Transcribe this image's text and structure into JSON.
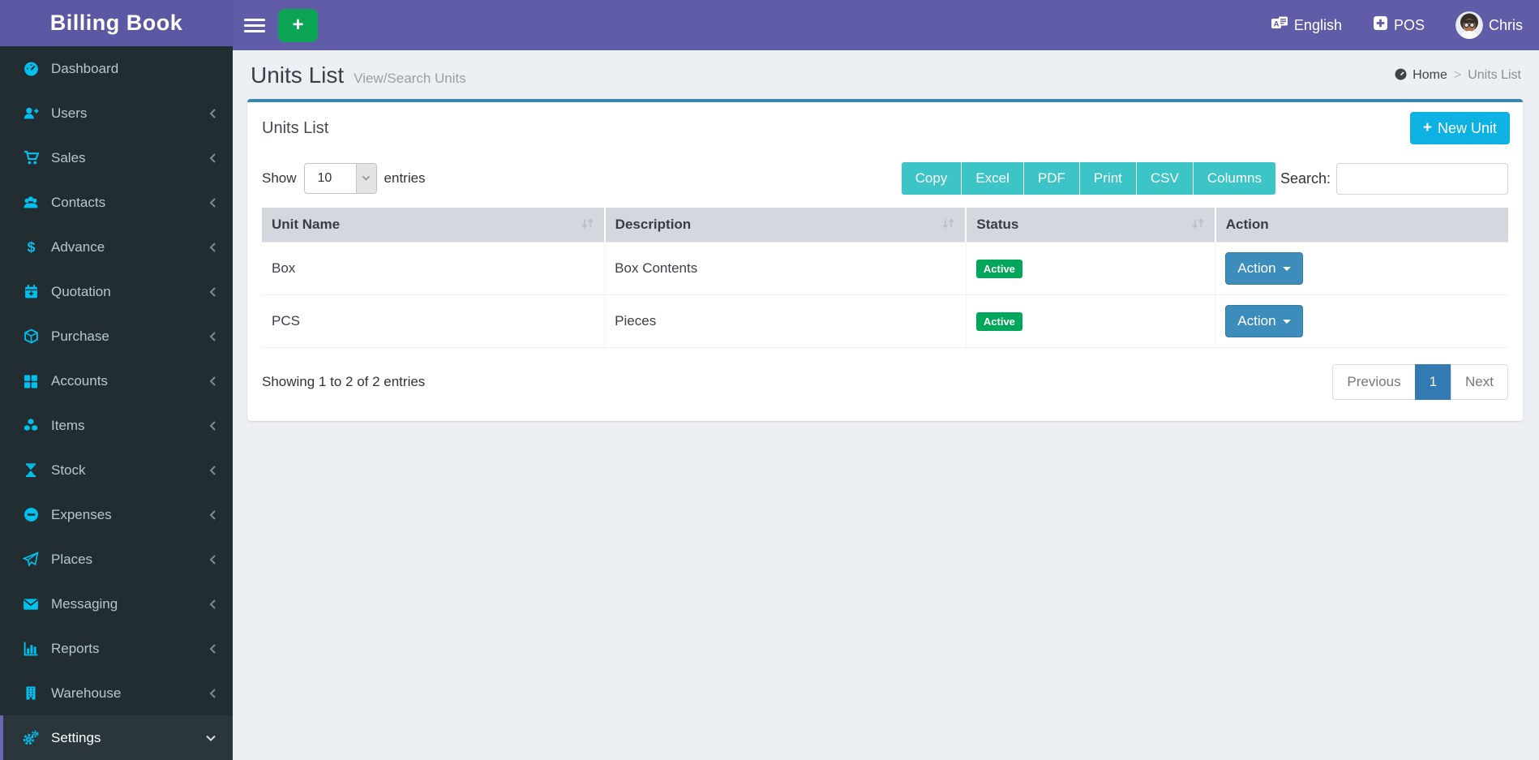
{
  "app": {
    "title": "Billing Book"
  },
  "navbar": {
    "language_label": "English",
    "pos_label": "POS",
    "user_name": "Chris",
    "icons": {
      "menu": "hamburger-icon",
      "quick_add": "plus-icon",
      "language": "language-icon",
      "pos": "plus-square-icon",
      "user": "avatar"
    }
  },
  "sidebar": {
    "items": [
      {
        "label": "Dashboard",
        "icon": "dashboard-icon",
        "expandable": false,
        "active": false
      },
      {
        "label": "Users",
        "icon": "user-plus-icon",
        "expandable": true,
        "active": false
      },
      {
        "label": "Sales",
        "icon": "cart-icon",
        "expandable": true,
        "active": false
      },
      {
        "label": "Contacts",
        "icon": "users-icon",
        "expandable": true,
        "active": false
      },
      {
        "label": "Advance",
        "icon": "dollar-icon",
        "expandable": true,
        "active": false
      },
      {
        "label": "Quotation",
        "icon": "calendar-plus-icon",
        "expandable": true,
        "active": false
      },
      {
        "label": "Purchase",
        "icon": "cube-icon",
        "expandable": true,
        "active": false
      },
      {
        "label": "Accounts",
        "icon": "grid-icon",
        "expandable": true,
        "active": false
      },
      {
        "label": "Items",
        "icon": "cubes-icon",
        "expandable": true,
        "active": false
      },
      {
        "label": "Stock",
        "icon": "hourglass-icon",
        "expandable": true,
        "active": false
      },
      {
        "label": "Expenses",
        "icon": "minus-circle-icon",
        "expandable": true,
        "active": false
      },
      {
        "label": "Places",
        "icon": "paper-plane-icon",
        "expandable": true,
        "active": false
      },
      {
        "label": "Messaging",
        "icon": "envelope-icon",
        "expandable": true,
        "active": false
      },
      {
        "label": "Reports",
        "icon": "bar-chart-icon",
        "expandable": true,
        "active": false
      },
      {
        "label": "Warehouse",
        "icon": "building-icon",
        "expandable": true,
        "active": false
      },
      {
        "label": "Settings",
        "icon": "cogs-icon",
        "expandable": true,
        "active": true,
        "expanded": true
      }
    ]
  },
  "page": {
    "title": "Units List",
    "subtitle": "View/Search Units",
    "breadcrumb": {
      "home": "Home",
      "current": "Units List",
      "home_icon": "dashboard-icon"
    }
  },
  "card": {
    "title": "Units List",
    "new_unit_label": "New Unit"
  },
  "controls": {
    "show_label": "Show",
    "page_length": "10",
    "entries_label": "entries",
    "export_buttons": [
      "Copy",
      "Excel",
      "PDF",
      "Print",
      "CSV",
      "Columns"
    ],
    "search_label": "Search:",
    "search_value": "",
    "search_placeholder": ""
  },
  "table": {
    "columns": [
      "Unit Name",
      "Description",
      "Status",
      "Action"
    ],
    "sortable_columns": [
      "Unit Name",
      "Description",
      "Status"
    ],
    "rows": [
      {
        "unit_name": "Box",
        "description": "Box Contents",
        "status": "Active",
        "action": "Action"
      },
      {
        "unit_name": "PCS",
        "description": "Pieces",
        "status": "Active",
        "action": "Action"
      }
    ]
  },
  "footer": {
    "info": "Showing 1 to 2 of 2 entries",
    "pagination": {
      "previous": "Previous",
      "current_page": "1",
      "next": "Next"
    }
  },
  "colors": {
    "navbar_purple": "#605ca8",
    "sidebar_dark": "#222d32",
    "sidebar_icon_cyan": "#00c0ef",
    "card_top_border_blue": "#3a87ad",
    "new_button_aqua": "#0db1e2",
    "export_teal": "#3cc4c6",
    "action_blue": "#3d8dbc",
    "status_green": "#00a65a",
    "quick_add_green": "#0ba455",
    "pagination_active_blue": "#3379b2",
    "content_bg": "#ecf0f5"
  }
}
